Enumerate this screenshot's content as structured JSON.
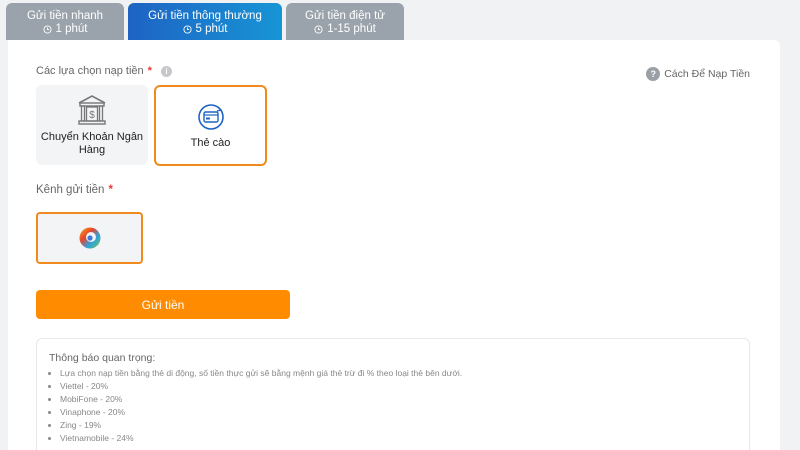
{
  "tabs": [
    {
      "label": "Gửi tiền nhanh",
      "time": "1 phút",
      "active": false
    },
    {
      "label": "Gửi tiền thông thường",
      "time": "5 phút",
      "active": true
    },
    {
      "label": "Gửi tiền điện tử",
      "time": "1-15 phút",
      "active": false
    }
  ],
  "deposit_options": {
    "label": "Các lựa chọn nạp tiền",
    "required": "*",
    "how_to_link": "Cách Để Nạp Tiền",
    "items": [
      {
        "label_line1": "Chuyển Khoản Ngân",
        "label_line2": "Hàng",
        "icon": "bank-icon",
        "selected": false
      },
      {
        "label": "Thẻ cào",
        "icon": "scratch-card-icon",
        "selected": true
      }
    ]
  },
  "channel": {
    "label": "Kênh gửi tiền",
    "required": "*",
    "icon": "channel-logo-icon"
  },
  "submit_label": "Gửi tiền",
  "notice": {
    "title": "Thông báo quan trọng:",
    "items": [
      "Lựa chọn nạp tiền bằng thẻ di động, số tiền thực gửi sẽ bằng mệnh giá thẻ trừ đi % theo loại thẻ bên dưới.",
      "Viettel - 20%",
      "MobiFone - 20%",
      "Vinaphone - 20%",
      "Zing - 19%",
      "Vietnamobile - 24%"
    ]
  },
  "colors": {
    "accent_orange": "#ff8c00",
    "active_tab_blue": "#1e63c3",
    "inactive_tab": "#9aa3ab"
  }
}
